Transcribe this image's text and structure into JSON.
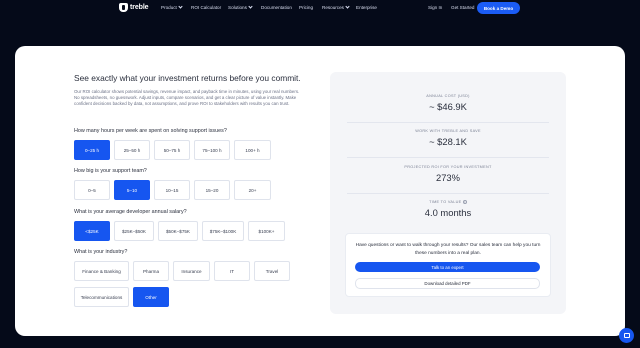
{
  "nav": {
    "brand": "treble",
    "links": [
      {
        "label": "Product",
        "dropdown": true
      },
      {
        "label": "ROI Calculator",
        "dropdown": false
      },
      {
        "label": "Solutions",
        "dropdown": true
      },
      {
        "label": "Documentation",
        "dropdown": false
      },
      {
        "label": "Pricing",
        "dropdown": false
      },
      {
        "label": "Resources",
        "dropdown": true
      },
      {
        "label": "Enterprise",
        "dropdown": false
      }
    ],
    "signin": "Sign In",
    "get_started": "Get Started",
    "demo": "Book a Demo"
  },
  "calculator": {
    "title": "See exactly what your investment returns before you commit.",
    "intro": "Our ROI calculator shows potential savings, revenue impact, and payback time in minutes, using your real numbers. No spreadsheets, no guesswork. Adjust inputs, compare scenarios, and get a clear picture of value instantly. Make confident decisions backed by data, not assumptions, and prove ROI to stakeholders with results you can trust.",
    "questions": [
      {
        "label": "How many hours per week are spent on solving support issues?",
        "options": [
          "0–25 h",
          "25–50 h",
          "50–75 h",
          "75–100 h",
          "100+ h"
        ],
        "selected": 0
      },
      {
        "label": "How big is your support team?",
        "options": [
          "0–5",
          "5–10",
          "10–15",
          "15–20",
          "20+"
        ],
        "selected": 1
      },
      {
        "label": "What is your average developer annual salary?",
        "options": [
          "<$25K",
          "$25K–$50K",
          "$50K–$75K",
          "$75K–$100K",
          "$100K+"
        ],
        "selected": 0
      },
      {
        "label": "What is your industry?",
        "options": [
          "Finance & Banking",
          "Pharma",
          "Insurance",
          "IT",
          "Travel",
          "Telecommunications",
          "Other"
        ],
        "selected": 6
      }
    ]
  },
  "results": {
    "metrics": [
      {
        "label": "ANNUAL COST (USD)",
        "value": "~ $46.9K"
      },
      {
        "label": "WORK WITH TREBLE AND SAVE",
        "value": "~ $28.1K"
      },
      {
        "label": "PROJECTED ROI FOR YOUR INVESTMENT",
        "value": "273%"
      },
      {
        "label": "TIME TO VALUE",
        "value": "4.0 months"
      }
    ],
    "info_icon": "i",
    "cta_text": "Have questions or want to walk through your results? Our sales team can help you turn these numbers into a real plan.",
    "talk_button": "Talk to an expert",
    "pdf_button": "Download detailed PDF"
  },
  "colors": {
    "accent": "#1656f0",
    "background": "#050a19"
  }
}
